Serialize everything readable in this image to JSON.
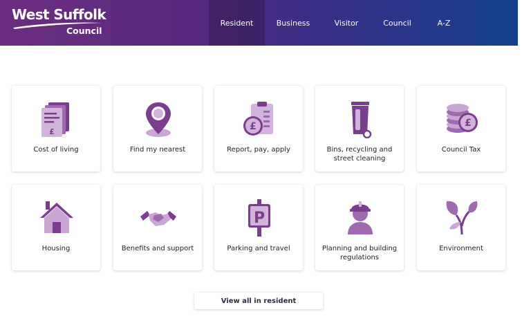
{
  "header": {
    "logo": {
      "line1": "West Suffolk",
      "line2": "Council"
    },
    "nav": [
      {
        "label": "Resident",
        "active": true
      },
      {
        "label": "Business",
        "active": false
      },
      {
        "label": "Visitor",
        "active": false
      },
      {
        "label": "Council",
        "active": false
      },
      {
        "label": "A-Z",
        "active": false
      }
    ]
  },
  "tiles": [
    {
      "label": "Cost of living",
      "icon": "documents-pound-icon"
    },
    {
      "label": "Find my nearest",
      "icon": "map-pin-icon"
    },
    {
      "label": "Report, pay, apply",
      "icon": "clipboard-pound-icon"
    },
    {
      "label": "Bins, recycling and street cleaning",
      "icon": "wheelie-bin-icon"
    },
    {
      "label": "Council Tax",
      "icon": "coins-pound-icon"
    },
    {
      "label": "Housing",
      "icon": "house-icon"
    },
    {
      "label": "Benefits and support",
      "icon": "handshake-icon"
    },
    {
      "label": "Parking and travel",
      "icon": "parking-sign-icon"
    },
    {
      "label": "Planning and building regulations",
      "icon": "builder-icon"
    },
    {
      "label": "Environment",
      "icon": "plant-icon"
    }
  ],
  "view_all": {
    "label": "View all in resident"
  },
  "colors": {
    "icon_dark": "#7b3d8d",
    "icon_light": "#c9a6d3",
    "header_start": "#6b2c7e",
    "header_end": "#15408f"
  }
}
